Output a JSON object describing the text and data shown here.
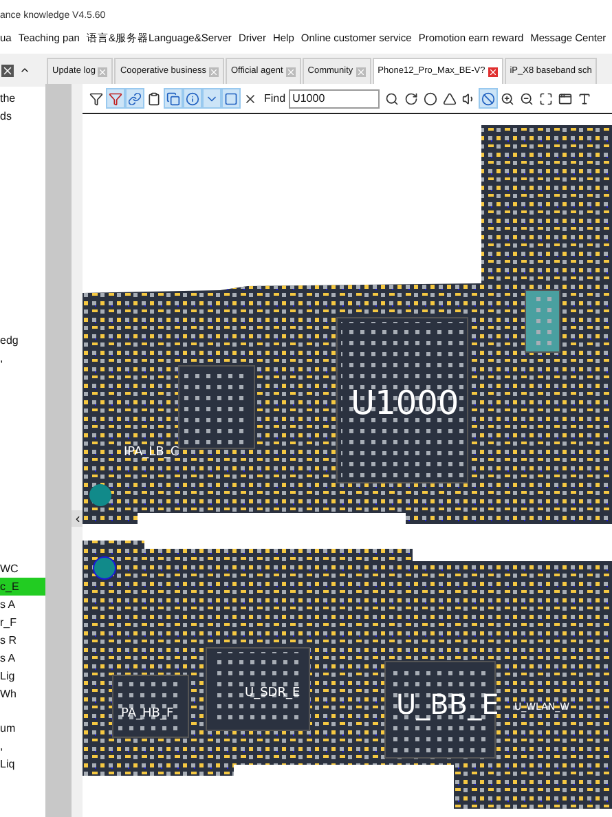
{
  "window": {
    "title": "ance knowledge V4.5.60"
  },
  "menu": [
    "ua",
    "Teaching pan",
    "语言&服务器Language&Server",
    "Driver",
    "Help",
    "Online customer service",
    "Promotion earn reward",
    "Message Center"
  ],
  "tabs": [
    {
      "label": "Update log",
      "selected": false
    },
    {
      "label": "Cooperative business",
      "selected": false
    },
    {
      "label": "Official agent",
      "selected": false
    },
    {
      "label": "Community",
      "selected": false
    },
    {
      "label": "Phone12_Pro_Max_BE-V?",
      "selected": true
    },
    {
      "label": "iP_X8 baseband sch",
      "selected": false
    }
  ],
  "sidebar": {
    "items": [
      {
        "label": "the",
        "selected": false
      },
      {
        "label": "ds",
        "selected": false
      },
      {
        "label": "edg",
        "selected": false
      },
      {
        "label": ",",
        "selected": false
      },
      {
        "label": "WC",
        "selected": false
      },
      {
        "label": "c_E",
        "selected": true
      },
      {
        "label": "s A",
        "selected": false
      },
      {
        "label": "r_F",
        "selected": false
      },
      {
        "label": "s R",
        "selected": false
      },
      {
        "label": "s A",
        "selected": false
      },
      {
        "label": "Lig",
        "selected": false
      },
      {
        "label": "Wh",
        "selected": false
      },
      {
        "label": "um",
        "selected": false
      },
      {
        "label": ",",
        "selected": false
      },
      {
        "label": "Liq",
        "selected": false
      }
    ]
  },
  "toolbar": {
    "tools": [
      {
        "kind": "funnel",
        "active": false
      },
      {
        "kind": "red-funnel",
        "active": true
      },
      {
        "kind": "link",
        "active": true
      },
      {
        "kind": "clipboard",
        "active": false
      },
      {
        "kind": "copy",
        "active": true
      },
      {
        "kind": "info",
        "active": true
      },
      {
        "kind": "chevron",
        "active": true
      },
      {
        "kind": "square",
        "active": true
      },
      {
        "kind": "x",
        "active": false
      }
    ],
    "find": {
      "label": "Find",
      "value": "U1000"
    },
    "view_tools": [
      {
        "kind": "search",
        "active": false
      },
      {
        "kind": "rotate",
        "active": false
      },
      {
        "kind": "circle",
        "active": false
      },
      {
        "kind": "triangle",
        "active": false
      },
      {
        "kind": "speaker",
        "active": false
      },
      {
        "kind": "ban",
        "active": true
      },
      {
        "kind": "zoom-in",
        "active": false
      },
      {
        "kind": "zoom-out",
        "active": false
      },
      {
        "kind": "fit",
        "active": false
      },
      {
        "kind": "window",
        "active": false
      },
      {
        "kind": "type",
        "active": false
      }
    ]
  },
  "board": {
    "labels": [
      "U1000",
      "IPA_LB_C",
      "PA_HB_F",
      "U_SDR_E",
      "U_BB_E",
      "U_WLAN_W"
    ]
  }
}
